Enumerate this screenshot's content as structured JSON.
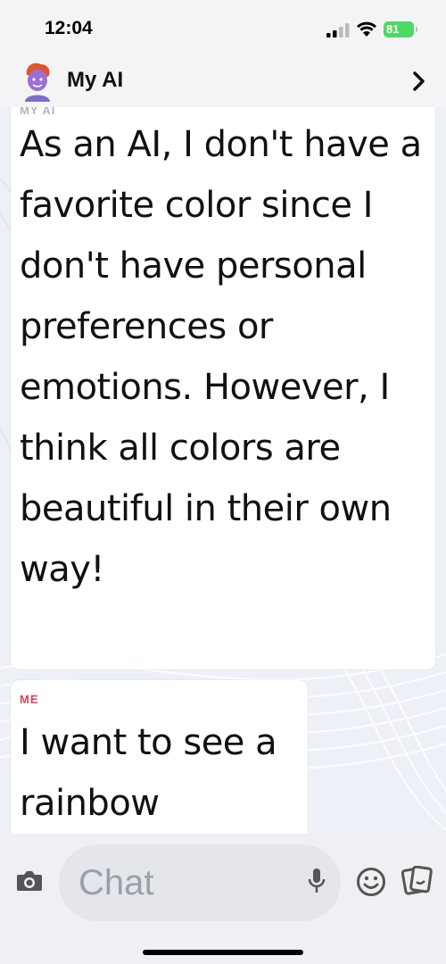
{
  "status_bar": {
    "time": "12:04",
    "battery": "81"
  },
  "header": {
    "title": "My AI"
  },
  "messages": [
    {
      "sender": "MY AI",
      "text": "As an AI, I don't have a favorite color since I don't have personal preferences or emotions. However, I think all colors are beautiful in their own way!"
    },
    {
      "sender": "ME",
      "text": "I want to see a rainbow"
    }
  ],
  "composer": {
    "placeholder": "Chat"
  },
  "colors": {
    "me_label": "#e0405a",
    "battery": "#4cd964"
  }
}
